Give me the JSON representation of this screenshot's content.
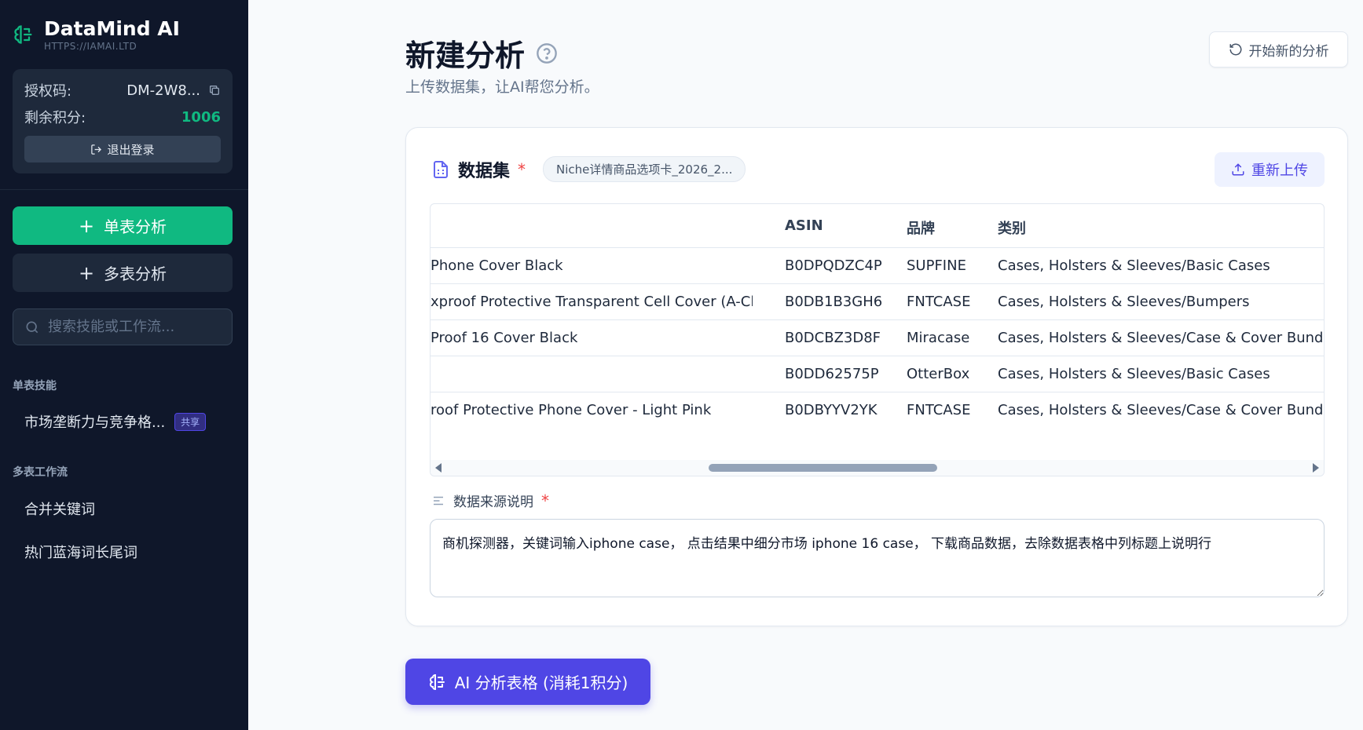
{
  "brand": {
    "title": "DataMind AI",
    "url": "HTTPS://IAMAI.LTD"
  },
  "auth": {
    "code_label": "授权码:",
    "code_value": "DM-2W8...",
    "points_label": "剩余积分:",
    "points_value": "1006",
    "logout_label": "退出登录"
  },
  "sidebar": {
    "single_btn": "单表分析",
    "multi_btn": "多表分析",
    "search_placeholder": "搜索技能或工作流...",
    "single_section": "单表技能",
    "single_items": [
      {
        "label": "市场垄断力与竞争格...",
        "badge": "共享"
      }
    ],
    "multi_section": "多表工作流",
    "multi_items": [
      {
        "label": "合并关键词"
      },
      {
        "label": "热门蓝海词长尾词"
      }
    ]
  },
  "header": {
    "title": "新建分析",
    "subtitle": "上传数据集，让AI帮您分析。",
    "restart_label": "开始新的分析"
  },
  "dataset": {
    "label": "数据集",
    "required_mark": "*",
    "file_name": "Niche详情商品选项卡_2026_2...",
    "reupload_label": "重新上传",
    "columns": [
      "ASIN",
      "品牌",
      "类别"
    ],
    "rows": [
      {
        "title": "Phone Cover Black",
        "asin": "B0DPQDZC4P",
        "brand": "SUPFINE",
        "category": "Cases, Holsters & Sleeves/Basic Cases"
      },
      {
        "title": "xproof Protective Transparent Cell Cover (A-Clear)",
        "asin": "B0DB1B3GH6",
        "brand": "FNTCASE",
        "category": "Cases, Holsters & Sleeves/Bumpers"
      },
      {
        "title": "Proof 16 Cover Black",
        "asin": "B0DCBZ3D8F",
        "brand": "Miracase",
        "category": "Cases, Holsters & Sleeves/Case & Cover Bundles"
      },
      {
        "title": "",
        "asin": "B0DD62575P",
        "brand": "OtterBox",
        "category": "Cases, Holsters & Sleeves/Basic Cases"
      },
      {
        "title": "roof Protective Phone Cover - Light Pink",
        "asin": "B0DBYYV2YK",
        "brand": "FNTCASE",
        "category": "Cases, Holsters & Sleeves/Case & Cover Bundles"
      }
    ]
  },
  "source": {
    "label": "数据来源说明",
    "required_mark": "*",
    "value": "商机探测器，关键词输入iphone case， 点击结果中细分市场 iphone 16 case， 下载商品数据，去除数据表格中列标题上说明行"
  },
  "action": {
    "analyze_label": "AI 分析表格 (消耗1积分)"
  },
  "colors": {
    "accent": "#4f46e5",
    "green": "#10b981",
    "sidebar_bg": "#0f172a"
  }
}
